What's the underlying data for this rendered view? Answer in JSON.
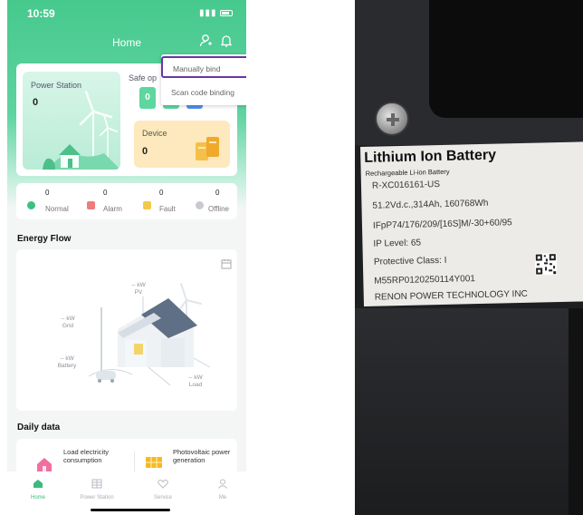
{
  "app": {
    "status_time": "10:59",
    "title": "Home"
  },
  "summary": {
    "power_station_label": "Power Station",
    "power_station_value": "0",
    "safe_label": "Safe op",
    "safe_values": [
      "0"
    ],
    "device_label": "Device",
    "device_value": "0"
  },
  "status": [
    {
      "count": "0",
      "label": "Normal",
      "color": "#3cc27f"
    },
    {
      "count": "0",
      "label": "Alarm",
      "color": "#f07b7b"
    },
    {
      "count": "0",
      "label": "Fault",
      "color": "#f2c94c"
    },
    {
      "count": "0",
      "label": "Offline",
      "color": "#c7cbd0"
    }
  ],
  "energy_flow": {
    "title": "Energy Flow",
    "pv": {
      "value": "-- kW",
      "label": "PV"
    },
    "grid": {
      "value": "-- kW",
      "label": "Grid"
    },
    "battery": {
      "value": "-- kW",
      "label": "Battery"
    },
    "load": {
      "value": "-- kW",
      "label": "Load"
    }
  },
  "daily": {
    "title": "Daily data",
    "load_label": "Load electricity consumption",
    "pv_label": "Photovoltaic power generation"
  },
  "tabs": [
    {
      "label": "Home",
      "active": true
    },
    {
      "label": "Power Station",
      "active": false
    },
    {
      "label": "Service",
      "active": false
    },
    {
      "label": "Me",
      "active": false
    }
  ],
  "popup": {
    "manual": "Manually bind",
    "scan": "Scan code binding",
    "highlight_color": "#6a35a5"
  },
  "battery_label": {
    "title": "Lithium Ion Battery",
    "subtitle": "Rechargeable Li-ion Battery",
    "model": "R-XC016161-US",
    "specs": "51.2Vd.c.,314Ah, 160768Wh",
    "cell_code": "IFpP74/176/209/[16S]M/-30+60/95",
    "ip_level": "IP Level: 65",
    "protective_class": "Protective Class: I",
    "serial": "M55RP0120250114Y001",
    "manufacturer": "RENON POWER TECHNOLOGY INC"
  },
  "colors": {
    "brand_green": "#46c98d",
    "device_card": "#fde9bd"
  }
}
